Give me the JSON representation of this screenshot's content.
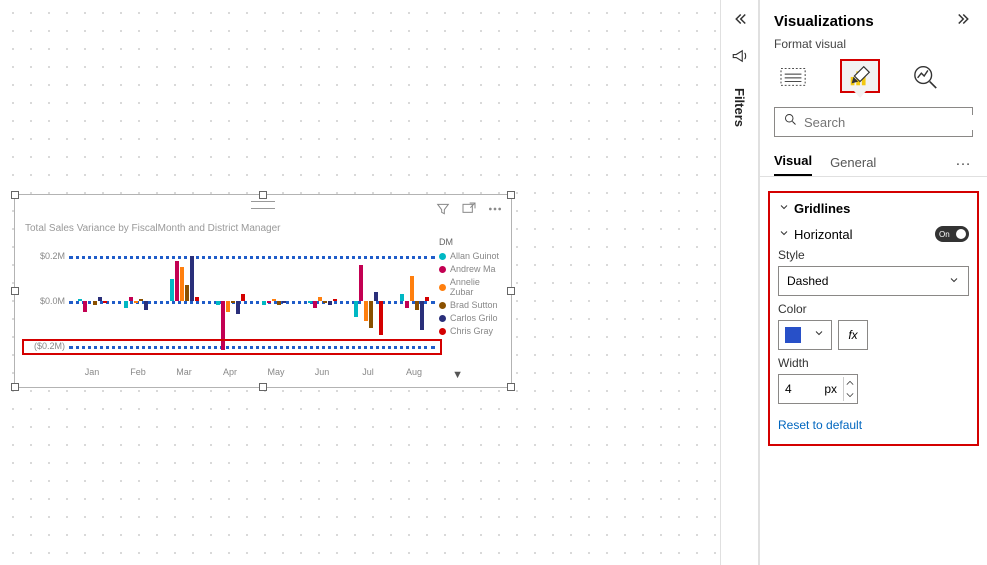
{
  "filters": {
    "label": "Filters"
  },
  "pane": {
    "title": "Visualizations",
    "subtitle": "Format visual",
    "search_placeholder": "Search",
    "tabs": {
      "visual": "Visual",
      "general": "General",
      "more": "…"
    },
    "tools": {
      "data": "data-table-icon",
      "format": "paint-roller-icon",
      "analytics": "magnifier-chart-icon"
    }
  },
  "gridlines": {
    "title": "Gridlines",
    "horiz": {
      "label": "Horizontal",
      "switch_label": "On",
      "style_label": "Style",
      "style_value": "Dashed",
      "color_label": "Color",
      "color_value": "#2850c8",
      "fx_label": "fx",
      "width_label": "Width",
      "width_value": "4",
      "width_unit": "px"
    },
    "reset": "Reset to default"
  },
  "visual": {
    "title": "Total Sales Variance by FiscalMonth and District Manager",
    "legend_title": "DM",
    "pager": "▼"
  },
  "legend": [
    {
      "color": "#00b8c4",
      "name": "Allan Guinot"
    },
    {
      "color": "#c30052",
      "name": "Andrew Ma"
    },
    {
      "color": "#ff7f0e",
      "name": "Annelie Zubar"
    },
    {
      "color": "#8a5000",
      "name": "Brad Sutton"
    },
    {
      "color": "#2a2f7a",
      "name": "Carlos Grilo"
    },
    {
      "color": "#d40000",
      "name": "Chris Gray"
    }
  ],
  "chart_data": {
    "type": "bar",
    "title": "Total Sales Variance by FiscalMonth and District Manager",
    "xlabel": "FiscalMonth",
    "ylabel": "Total Sales Variance",
    "yticks": [
      -0.2,
      0.0,
      0.2
    ],
    "ytick_labels": [
      "($0.2M)",
      "$0.0M",
      "$0.2M"
    ],
    "ylim": [
      -0.25,
      0.25
    ],
    "categories": [
      "Jan",
      "Feb",
      "Mar",
      "Apr",
      "May",
      "Jun",
      "Jul",
      "Aug"
    ],
    "series": [
      {
        "name": "Allan Guinot",
        "color": "#00b8c4",
        "values": [
          0.01,
          -0.03,
          0.1,
          -0.02,
          -0.02,
          -0.01,
          -0.07,
          0.03
        ]
      },
      {
        "name": "Andrew Ma",
        "color": "#c30052",
        "values": [
          -0.05,
          0.02,
          0.18,
          -0.22,
          -0.01,
          -0.03,
          0.16,
          -0.03
        ]
      },
      {
        "name": "Annelie Zubar",
        "color": "#ff7f0e",
        "values": [
          0.0,
          -0.01,
          0.15,
          -0.05,
          0.01,
          0.02,
          -0.09,
          0.11
        ]
      },
      {
        "name": "Brad Sutton",
        "color": "#8a5000",
        "values": [
          -0.02,
          0.01,
          0.07,
          -0.01,
          -0.02,
          -0.01,
          -0.12,
          -0.04
        ]
      },
      {
        "name": "Carlos Grilo",
        "color": "#2a2f7a",
        "values": [
          0.02,
          -0.04,
          0.2,
          -0.06,
          -0.01,
          -0.02,
          0.04,
          -0.13
        ]
      },
      {
        "name": "Chris Gray",
        "color": "#d40000",
        "values": [
          -0.01,
          0.0,
          0.02,
          0.03,
          0.0,
          0.01,
          -0.15,
          0.02
        ]
      }
    ]
  }
}
